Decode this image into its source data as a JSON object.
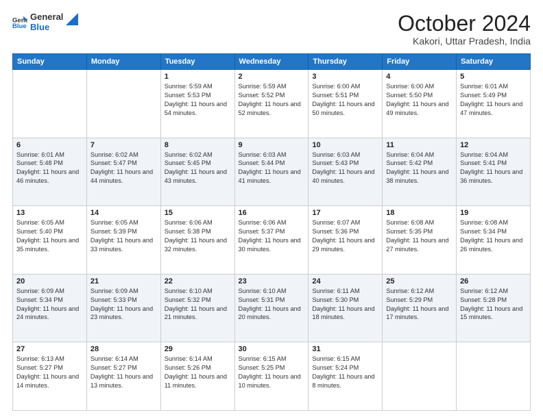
{
  "logo": {
    "line1": "General",
    "line2": "Blue"
  },
  "header": {
    "month": "October 2024",
    "location": "Kakori, Uttar Pradesh, India"
  },
  "weekdays": [
    "Sunday",
    "Monday",
    "Tuesday",
    "Wednesday",
    "Thursday",
    "Friday",
    "Saturday"
  ],
  "weeks": [
    [
      {
        "day": "",
        "sunrise": "",
        "sunset": "",
        "daylight": ""
      },
      {
        "day": "",
        "sunrise": "",
        "sunset": "",
        "daylight": ""
      },
      {
        "day": "1",
        "sunrise": "Sunrise: 5:59 AM",
        "sunset": "Sunset: 5:53 PM",
        "daylight": "Daylight: 11 hours and 54 minutes."
      },
      {
        "day": "2",
        "sunrise": "Sunrise: 5:59 AM",
        "sunset": "Sunset: 5:52 PM",
        "daylight": "Daylight: 11 hours and 52 minutes."
      },
      {
        "day": "3",
        "sunrise": "Sunrise: 6:00 AM",
        "sunset": "Sunset: 5:51 PM",
        "daylight": "Daylight: 11 hours and 50 minutes."
      },
      {
        "day": "4",
        "sunrise": "Sunrise: 6:00 AM",
        "sunset": "Sunset: 5:50 PM",
        "daylight": "Daylight: 11 hours and 49 minutes."
      },
      {
        "day": "5",
        "sunrise": "Sunrise: 6:01 AM",
        "sunset": "Sunset: 5:49 PM",
        "daylight": "Daylight: 11 hours and 47 minutes."
      }
    ],
    [
      {
        "day": "6",
        "sunrise": "Sunrise: 6:01 AM",
        "sunset": "Sunset: 5:48 PM",
        "daylight": "Daylight: 11 hours and 46 minutes."
      },
      {
        "day": "7",
        "sunrise": "Sunrise: 6:02 AM",
        "sunset": "Sunset: 5:47 PM",
        "daylight": "Daylight: 11 hours and 44 minutes."
      },
      {
        "day": "8",
        "sunrise": "Sunrise: 6:02 AM",
        "sunset": "Sunset: 5:45 PM",
        "daylight": "Daylight: 11 hours and 43 minutes."
      },
      {
        "day": "9",
        "sunrise": "Sunrise: 6:03 AM",
        "sunset": "Sunset: 5:44 PM",
        "daylight": "Daylight: 11 hours and 41 minutes."
      },
      {
        "day": "10",
        "sunrise": "Sunrise: 6:03 AM",
        "sunset": "Sunset: 5:43 PM",
        "daylight": "Daylight: 11 hours and 40 minutes."
      },
      {
        "day": "11",
        "sunrise": "Sunrise: 6:04 AM",
        "sunset": "Sunset: 5:42 PM",
        "daylight": "Daylight: 11 hours and 38 minutes."
      },
      {
        "day": "12",
        "sunrise": "Sunrise: 6:04 AM",
        "sunset": "Sunset: 5:41 PM",
        "daylight": "Daylight: 11 hours and 36 minutes."
      }
    ],
    [
      {
        "day": "13",
        "sunrise": "Sunrise: 6:05 AM",
        "sunset": "Sunset: 5:40 PM",
        "daylight": "Daylight: 11 hours and 35 minutes."
      },
      {
        "day": "14",
        "sunrise": "Sunrise: 6:05 AM",
        "sunset": "Sunset: 5:39 PM",
        "daylight": "Daylight: 11 hours and 33 minutes."
      },
      {
        "day": "15",
        "sunrise": "Sunrise: 6:06 AM",
        "sunset": "Sunset: 5:38 PM",
        "daylight": "Daylight: 11 hours and 32 minutes."
      },
      {
        "day": "16",
        "sunrise": "Sunrise: 6:06 AM",
        "sunset": "Sunset: 5:37 PM",
        "daylight": "Daylight: 11 hours and 30 minutes."
      },
      {
        "day": "17",
        "sunrise": "Sunrise: 6:07 AM",
        "sunset": "Sunset: 5:36 PM",
        "daylight": "Daylight: 11 hours and 29 minutes."
      },
      {
        "day": "18",
        "sunrise": "Sunrise: 6:08 AM",
        "sunset": "Sunset: 5:35 PM",
        "daylight": "Daylight: 11 hours and 27 minutes."
      },
      {
        "day": "19",
        "sunrise": "Sunrise: 6:08 AM",
        "sunset": "Sunset: 5:34 PM",
        "daylight": "Daylight: 11 hours and 26 minutes."
      }
    ],
    [
      {
        "day": "20",
        "sunrise": "Sunrise: 6:09 AM",
        "sunset": "Sunset: 5:34 PM",
        "daylight": "Daylight: 11 hours and 24 minutes."
      },
      {
        "day": "21",
        "sunrise": "Sunrise: 6:09 AM",
        "sunset": "Sunset: 5:33 PM",
        "daylight": "Daylight: 11 hours and 23 minutes."
      },
      {
        "day": "22",
        "sunrise": "Sunrise: 6:10 AM",
        "sunset": "Sunset: 5:32 PM",
        "daylight": "Daylight: 11 hours and 21 minutes."
      },
      {
        "day": "23",
        "sunrise": "Sunrise: 6:10 AM",
        "sunset": "Sunset: 5:31 PM",
        "daylight": "Daylight: 11 hours and 20 minutes."
      },
      {
        "day": "24",
        "sunrise": "Sunrise: 6:11 AM",
        "sunset": "Sunset: 5:30 PM",
        "daylight": "Daylight: 11 hours and 18 minutes."
      },
      {
        "day": "25",
        "sunrise": "Sunrise: 6:12 AM",
        "sunset": "Sunset: 5:29 PM",
        "daylight": "Daylight: 11 hours and 17 minutes."
      },
      {
        "day": "26",
        "sunrise": "Sunrise: 6:12 AM",
        "sunset": "Sunset: 5:28 PM",
        "daylight": "Daylight: 11 hours and 15 minutes."
      }
    ],
    [
      {
        "day": "27",
        "sunrise": "Sunrise: 6:13 AM",
        "sunset": "Sunset: 5:27 PM",
        "daylight": "Daylight: 11 hours and 14 minutes."
      },
      {
        "day": "28",
        "sunrise": "Sunrise: 6:14 AM",
        "sunset": "Sunset: 5:27 PM",
        "daylight": "Daylight: 11 hours and 13 minutes."
      },
      {
        "day": "29",
        "sunrise": "Sunrise: 6:14 AM",
        "sunset": "Sunset: 5:26 PM",
        "daylight": "Daylight: 11 hours and 11 minutes."
      },
      {
        "day": "30",
        "sunrise": "Sunrise: 6:15 AM",
        "sunset": "Sunset: 5:25 PM",
        "daylight": "Daylight: 11 hours and 10 minutes."
      },
      {
        "day": "31",
        "sunrise": "Sunrise: 6:15 AM",
        "sunset": "Sunset: 5:24 PM",
        "daylight": "Daylight: 11 hours and 8 minutes."
      },
      {
        "day": "",
        "sunrise": "",
        "sunset": "",
        "daylight": ""
      },
      {
        "day": "",
        "sunrise": "",
        "sunset": "",
        "daylight": ""
      }
    ]
  ]
}
